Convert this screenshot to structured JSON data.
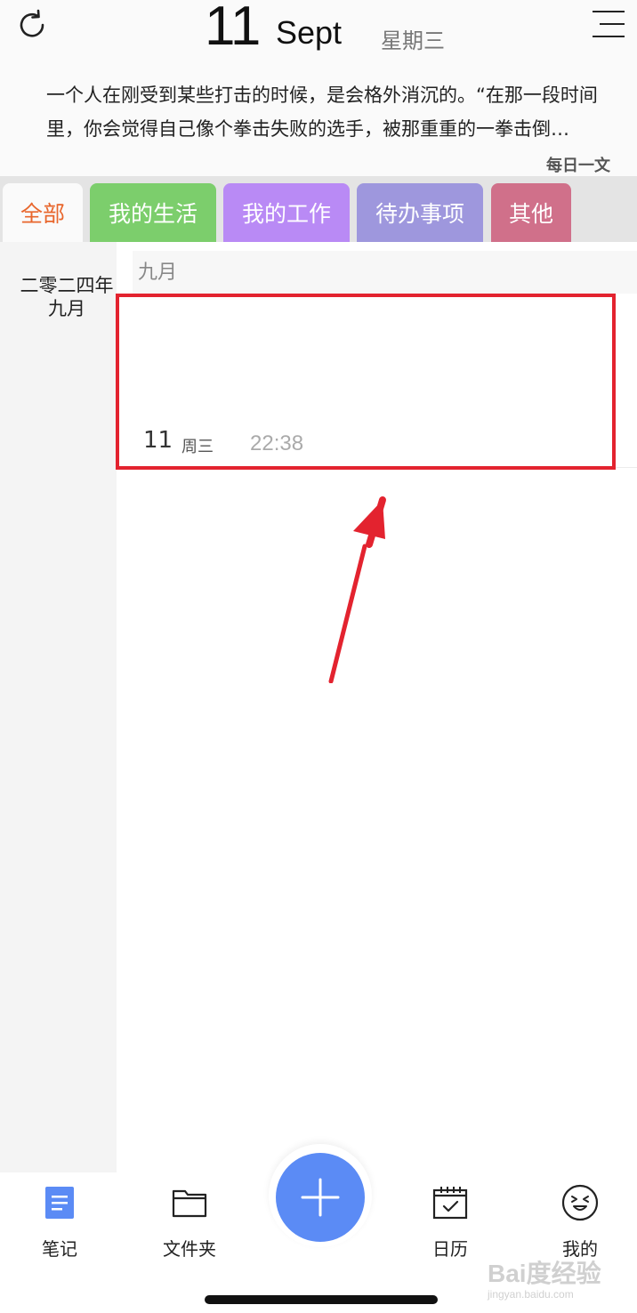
{
  "header": {
    "day": "11",
    "month": "Sept",
    "weekday": "星期三",
    "quote": "一个人在刚受到某些打击的时候，是会格外消沉的。“在那一段时间里，你会觉得自己像个拳击失败的选手，被那重重的一拳击倒…",
    "quote_source": "每日一文"
  },
  "tabs": [
    {
      "label": "全部",
      "color": "#fafafa",
      "active": true
    },
    {
      "label": "我的生活",
      "color": "#7cce6c"
    },
    {
      "label": "我的工作",
      "color": "#b98af5"
    },
    {
      "label": "待办事项",
      "color": "#9e97dd"
    },
    {
      "label": "其他",
      "color": "#d0708a"
    }
  ],
  "sidebar": {
    "year_line1": "二零二四年",
    "year_line2": "九月"
  },
  "content": {
    "month_header": "九月",
    "note": {
      "day": "11",
      "weekday": "周三",
      "time": "22:38"
    }
  },
  "bottom_nav": {
    "items": [
      {
        "label": "笔记",
        "icon": "note-document-icon",
        "active": true
      },
      {
        "label": "文件夹",
        "icon": "folder-icon"
      },
      {
        "label": "日历",
        "icon": "calendar-icon"
      },
      {
        "label": "我的",
        "icon": "face-icon"
      }
    ],
    "fab_icon": "plus-icon"
  },
  "watermark": {
    "main": "Bai度经验",
    "sub": "jingyan.baidu.com"
  },
  "colors": {
    "accent_orange": "#e8662c",
    "fab_blue": "#5b8bf5",
    "highlight_red": "#e3232f"
  }
}
